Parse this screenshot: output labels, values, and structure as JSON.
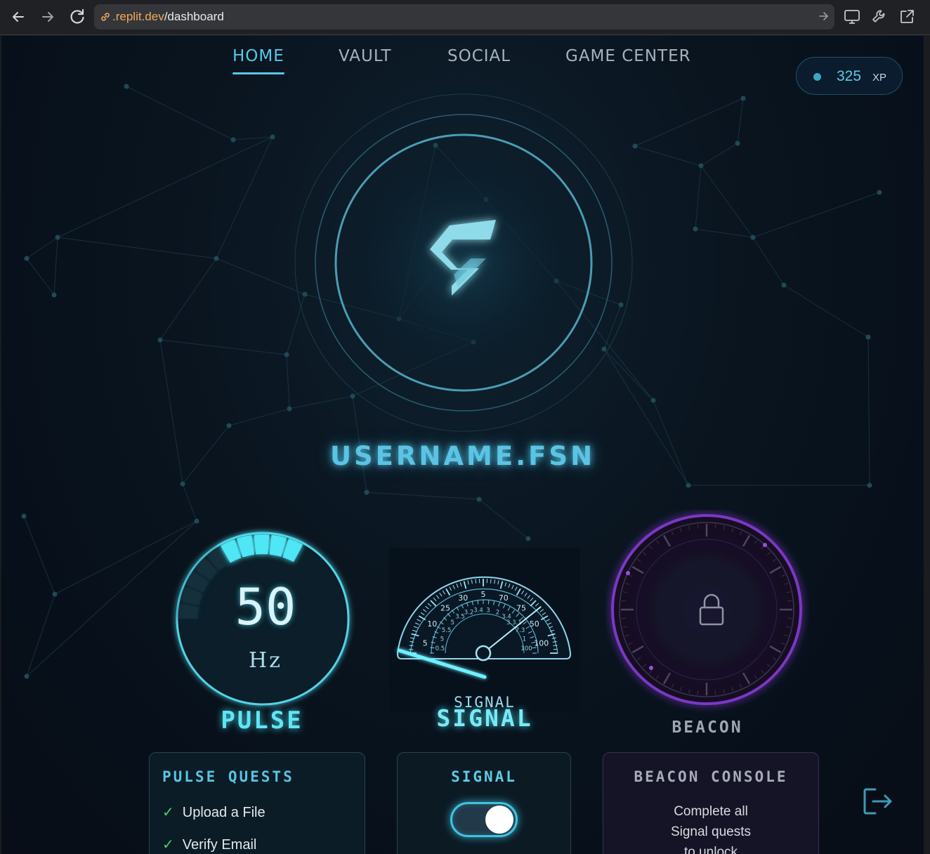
{
  "browser": {
    "url_host": ".replit.dev",
    "url_path": "/dashboard"
  },
  "nav": {
    "tabs": [
      {
        "label": "HOME",
        "active": true
      },
      {
        "label": "VAULT",
        "active": false
      },
      {
        "label": "SOCIAL",
        "active": false
      },
      {
        "label": "GAME CENTER",
        "active": false
      }
    ]
  },
  "xp": {
    "value": "325",
    "unit": "XP"
  },
  "profile": {
    "username": "USERNAME.FSN",
    "avatar_icon": "fsn-logo-icon"
  },
  "gauges": {
    "pulse": {
      "value": "50",
      "unit": "Hz",
      "label": "PULSE",
      "color": "#4fe6f6"
    },
    "signal": {
      "title": "SIGNAL",
      "label": "SIGNAL",
      "outer_ticks": [
        "5",
        "10",
        "25",
        "30",
        "5",
        "70",
        "75",
        "50",
        "100"
      ],
      "inner_ticks": [
        "0.5",
        "5",
        "5.5",
        "5",
        "3.5",
        "3.2",
        "3.4",
        "3",
        "2",
        "3.4",
        "3.3.1",
        "7.3",
        "1",
        "100"
      ],
      "color": "#4fe6f6"
    },
    "beacon": {
      "label": "BEACON",
      "locked": true,
      "lock_icon": "lock-icon",
      "color": "#9a4fe0"
    }
  },
  "panels": {
    "pulse_quests": {
      "title": "PULSE QUESTS",
      "items": [
        {
          "label": "Upload a File",
          "done": true
        },
        {
          "label": "Verify Email",
          "done": true
        }
      ]
    },
    "signal": {
      "title": "SIGNAL",
      "toggle_on": true
    },
    "beacon_console": {
      "title": "BEACON CONSOLE",
      "lines": [
        "Complete all",
        "Signal quests",
        "to unlock"
      ]
    }
  },
  "logout_icon": "logout-icon",
  "colors": {
    "accent": "#57c8e6",
    "glow": "#4fe6f6",
    "beacon": "#9a4fe0",
    "check": "#48d06d"
  }
}
